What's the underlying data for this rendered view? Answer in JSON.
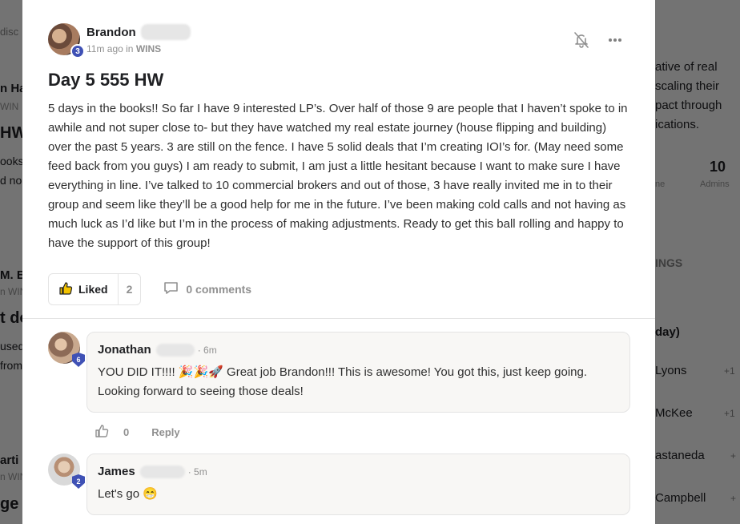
{
  "background": {
    "left_fragments": [
      "disc",
      "n Ha",
      "WIN",
      "HW",
      "ooks",
      "d no",
      "M. B",
      "n WIN",
      "t do",
      "used",
      "from",
      "arti",
      "n WIN",
      "ge"
    ],
    "right_fragments": [
      "ative of real",
      "scaling their",
      "pact through",
      "ications.",
      "ne",
      "10",
      "Admins",
      "INGS",
      "day)",
      "Lyons",
      "+1",
      "McKee",
      "+1",
      "astaneda",
      "+",
      "Campbell",
      "+"
    ]
  },
  "post": {
    "author": "Brandon",
    "level": "3",
    "time": "11m ago in",
    "category": "WINS",
    "title": "Day 5 555 HW",
    "body": "5 days in the books!! So far I have 9 interested LP’s. Over half of those 9 are people that I haven’t spoke to in awhile and not super close to- but they have watched my real estate journey (house flipping and building) over the past 5 years. 3 are still on the fence. I have 5 solid deals that I’m creating IOI’s for. (May need some feed back from you guys) I am ready to submit, I am just a little hesitant because I want to make sure I have everything in line. I’ve talked to 10 commercial brokers and out of those, 3 have really invited me in to their group and seem like they’ll be a good help for me in the future. I’ve been making cold calls and not having as much luck as I’d like but I’m in the process of making adjustments. Ready to get this ball rolling and happy to have the support of this group!",
    "like_label": "Liked",
    "like_count": "2",
    "comments_label": "0 comments",
    "icons": {
      "notify": "bell-off-icon",
      "more": "more-horizontal-icon",
      "like": "thumbs-up-icon",
      "comment": "comment-icon"
    }
  },
  "comments": [
    {
      "author": "Jonathan",
      "level": "6",
      "time": "· 6m",
      "text": "YOU DID IT!!!! 🎉🎉🚀 Great job Brandon!!! This is awesome! You got this, just keep going. Looking forward to seeing those deals!",
      "likes": "0",
      "reply_label": "Reply"
    },
    {
      "author": "James",
      "level": "2",
      "time": "· 5m",
      "text": "Let's go 😁"
    }
  ],
  "colors": {
    "badge": "#3f51b5",
    "like_icon": "#f2c200",
    "muted": "#909090"
  }
}
